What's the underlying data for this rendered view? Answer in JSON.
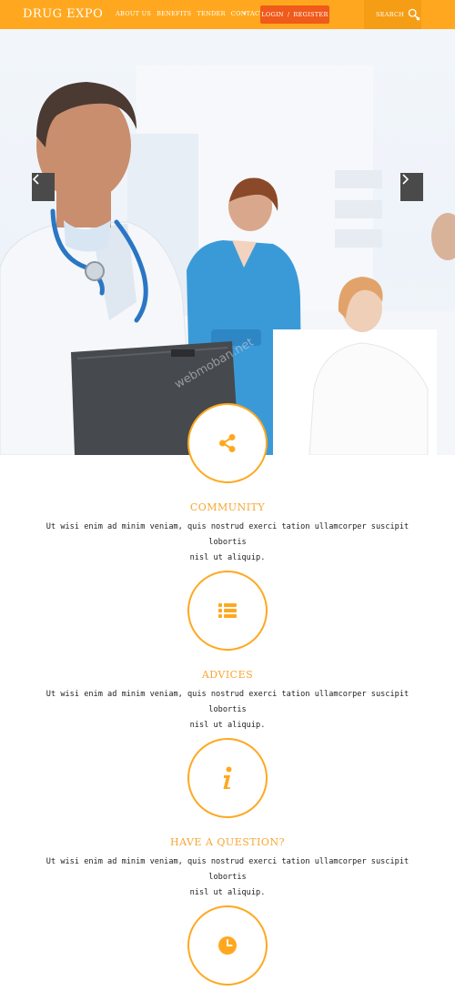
{
  "header": {
    "logo": "DRUG EXPO",
    "nav": [
      "ABOUT US",
      "BENEFITS",
      "TENDER",
      "CONTACT"
    ],
    "nav_more_icon": "caret-down-icon",
    "login_label": "LOGIN",
    "login_sep": "/",
    "register_label": "REGISTER",
    "search_label": "SEARCH",
    "search_icon": "magnifier-icon"
  },
  "hero": {
    "prev_icon": "chevron-left-icon",
    "next_icon": "chevron-right-icon"
  },
  "features": [
    {
      "icon": "share-icon",
      "title": "COMMUNITY",
      "line1": "Ut wisi enim ad minim veniam, quis nostrud exerci tation ullamcorper suscipit lobortis",
      "line2": "nisl ut aliquip."
    },
    {
      "icon": "list-icon",
      "title": "ADVICES",
      "line1": "Ut wisi enim ad minim veniam, quis nostrud exerci tation ullamcorper suscipit lobortis",
      "line2": "nisl ut aliquip."
    },
    {
      "icon": "info-icon",
      "title": "HAVE A QUESTION?",
      "line1": "Ut wisi enim ad minim veniam, quis nostrud exerci tation ullamcorper suscipit lobortis",
      "line2": "nisl ut aliquip."
    },
    {
      "icon": "clock-icon",
      "title": "",
      "line1": "",
      "line2": ""
    }
  ],
  "colors": {
    "accent": "#ffa81f",
    "login_bg": "#f05a1a",
    "search_bg": "#f59d14",
    "title": "#f8a531"
  }
}
